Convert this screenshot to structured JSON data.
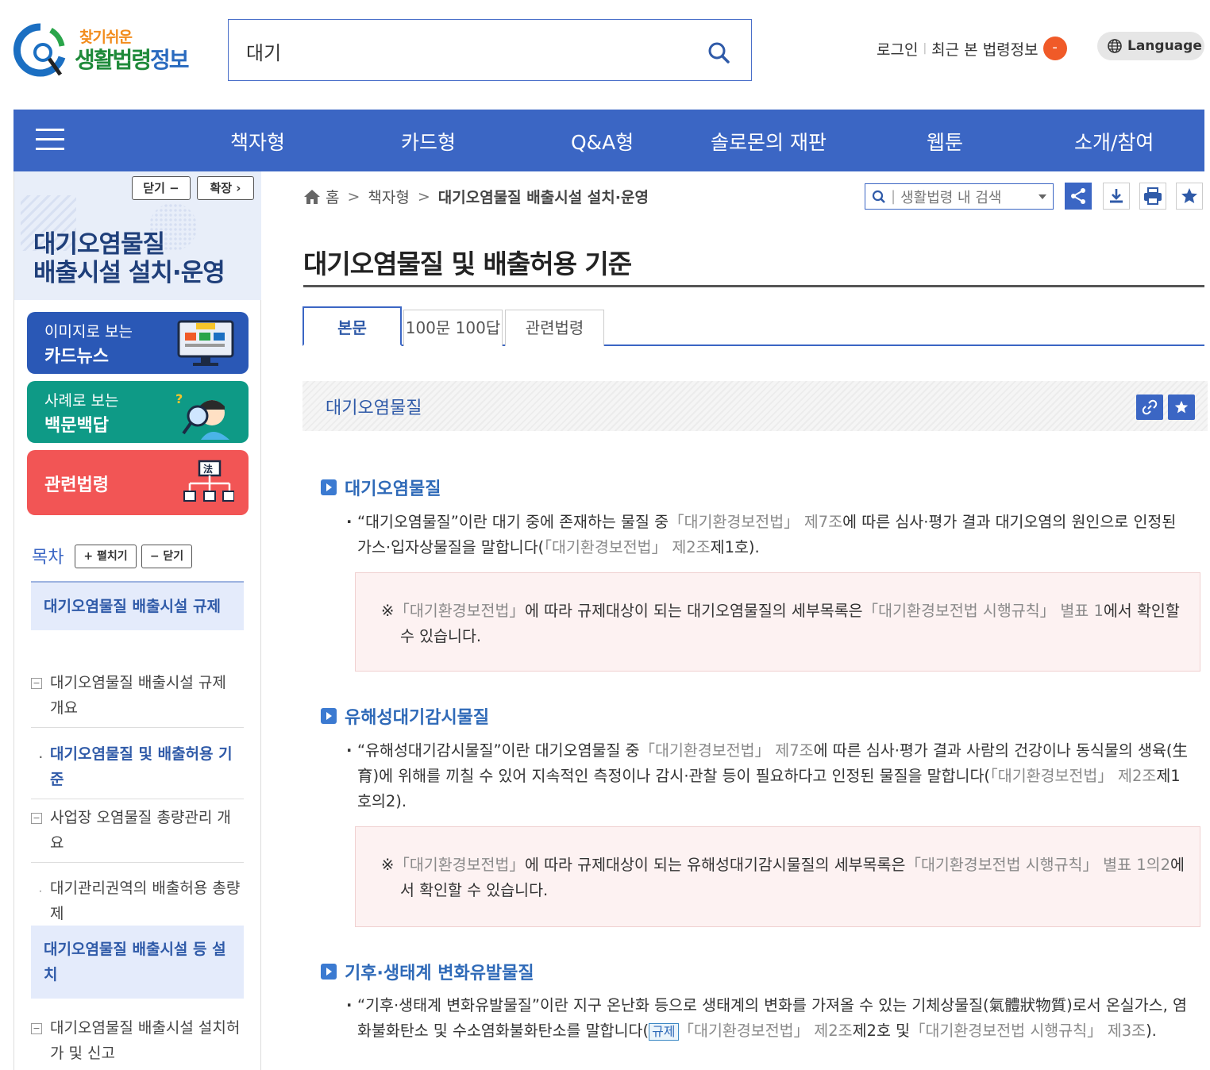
{
  "logo": {
    "small": "찾기쉬운",
    "big_a": "생활법령",
    "big_b": "정보"
  },
  "search": {
    "value": "대기"
  },
  "top_util": {
    "login": "로그인",
    "recent": "최근 본 법령정보",
    "recent_count": "-",
    "language": "Language"
  },
  "nav": {
    "items": [
      "책자형",
      "카드형",
      "Q&A형",
      "솔로몬의 재판",
      "웹툰",
      "소개/참여"
    ]
  },
  "sidebar": {
    "close_btn": "닫기 −",
    "expand_btn": "확장 ›",
    "title_line1": "대기오염물질",
    "title_line2": "배출시설 설치·운영",
    "promos": [
      {
        "t1": "이미지로 보는",
        "t2": "카드뉴스",
        "color": "#2a58b6"
      },
      {
        "t1": "사례로 보는",
        "t2": "백문백답",
        "color": "#0e9a86"
      },
      {
        "t1": "",
        "t2": "관련법령",
        "color": "#f25555"
      }
    ],
    "toc_label": "목차",
    "toc_expand": "+ 펼치기",
    "toc_collapse": "− 닫기",
    "toc": [
      "대기오염물질 배출시설 규제",
      "대기오염물질 배출시설 규제 개요",
      "대기오염물질 및 배출허용 기준",
      "사업장 오염물질 총량관리 개요",
      "대기관리권역의 배출허용 총량제",
      "대기오염물질 배출시설 등 설치",
      "대기오염물질 배출시설 설치허가 및 신고"
    ]
  },
  "breadcrumb": {
    "home": "홈",
    "level1": "책자형",
    "current": "대기오염물질 배출시설 설치·운영"
  },
  "in_search": {
    "placeholder": "생활법령 내 검색"
  },
  "page_title": "대기오염물질 및 배출허용 기준",
  "tabs": [
    "본문",
    "100문 100답",
    "관련법령"
  ],
  "section_label": "대기오염물질",
  "content": {
    "h1": "대기오염물질",
    "p1_a": "“대기오염물질”이란 대기 중에 존재하는 물질 중",
    "p1_law1": "「대기환경보전법」 제7조",
    "p1_b": "에 따른 심사·평가 결과 대기오염의 원인으로 인정된 가스·입자상물질을 말합니다(",
    "p1_law2": "「대기환경보전법」 제2조",
    "p1_c": "제1호).",
    "n1_a": "※",
    "n1_law1": "「대기환경보전법」",
    "n1_b": "에 따라 규제대상이 되는 대기오염물질의 세부목록은",
    "n1_law2": "「대기환경보전법 시행규칙」 별표 1",
    "n1_c": "에서 확인할 수 있습니다.",
    "h2": "유해성대기감시물질",
    "p2_a": "“유해성대기감시물질”이란 대기오염물질 중",
    "p2_law1": "「대기환경보전법」 제7조",
    "p2_b": "에 따른 심사·평가 결과 사람의 건강이나 동식물의 생육(生育)에 위해를 끼칠 수 있어 지속적인 측정이나 감시·관찰 등이 필요하다고 인정된 물질을 말합니다(",
    "p2_law2": "「대기환경보전법」 제2조",
    "p2_c": "제1호의2).",
    "n2_a": "※",
    "n2_law1": "「대기환경보전법」",
    "n2_b": "에 따라 규제대상이 되는 유해성대기감시물질의 세부목록은",
    "n2_law2": "「대기환경보전법 시행규칙」 별표 1의2",
    "n2_c": "에서 확인할 수 있습니다.",
    "h3": "기후·생태계 변화유발물질",
    "p3_a": "“기후·생태계 변화유발물질”이란 지구 온난화 등으로 생태계의 변화를 가져올 수 있는 기체상물질(氣體狀物質)로서 온실가스, 염화불화탄소 및 수소염화불화탄소를 말합니다(",
    "p3_tag": "규제",
    "p3_law1": "「대기환경보전법」 제2조",
    "p3_b": "제2호 및",
    "p3_law2": "「대기환경보전법 시행규칙」 제3조",
    "p3_c": ")."
  }
}
